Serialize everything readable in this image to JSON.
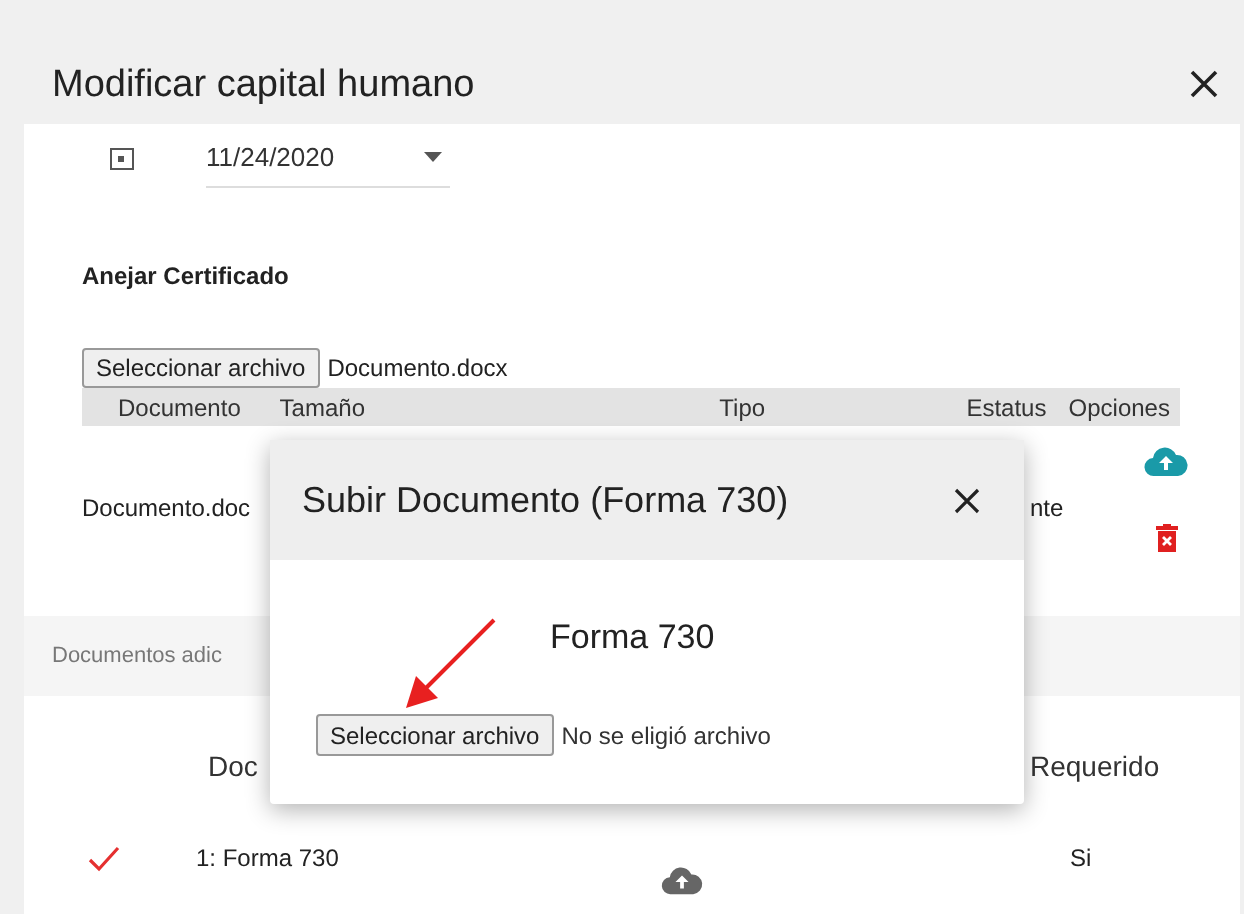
{
  "window": {
    "title": "Modificar capital humano"
  },
  "date_field": {
    "value": "11/24/2020"
  },
  "certificate": {
    "title": "Anejar Certificado",
    "file_button": "Seleccionar archivo",
    "file_name": "Documento.docx",
    "columns": [
      "Documento",
      "Tamaño",
      "Tipo",
      "Estatus",
      "Opciones"
    ],
    "rows": [
      {
        "document": "Documento.doc",
        "status": "nte"
      }
    ]
  },
  "additional": {
    "title": "Documentos adic",
    "columns": [
      "Doc",
      "Requerido"
    ],
    "rows": [
      {
        "checked": true,
        "document": "1: Forma 730",
        "required": "Si"
      }
    ]
  },
  "dialog": {
    "title": "Subir Documento (Forma 730)",
    "form_name": "Forma 730",
    "file_button": "Seleccionar archivo",
    "file_status": "No se eligió archivo"
  }
}
